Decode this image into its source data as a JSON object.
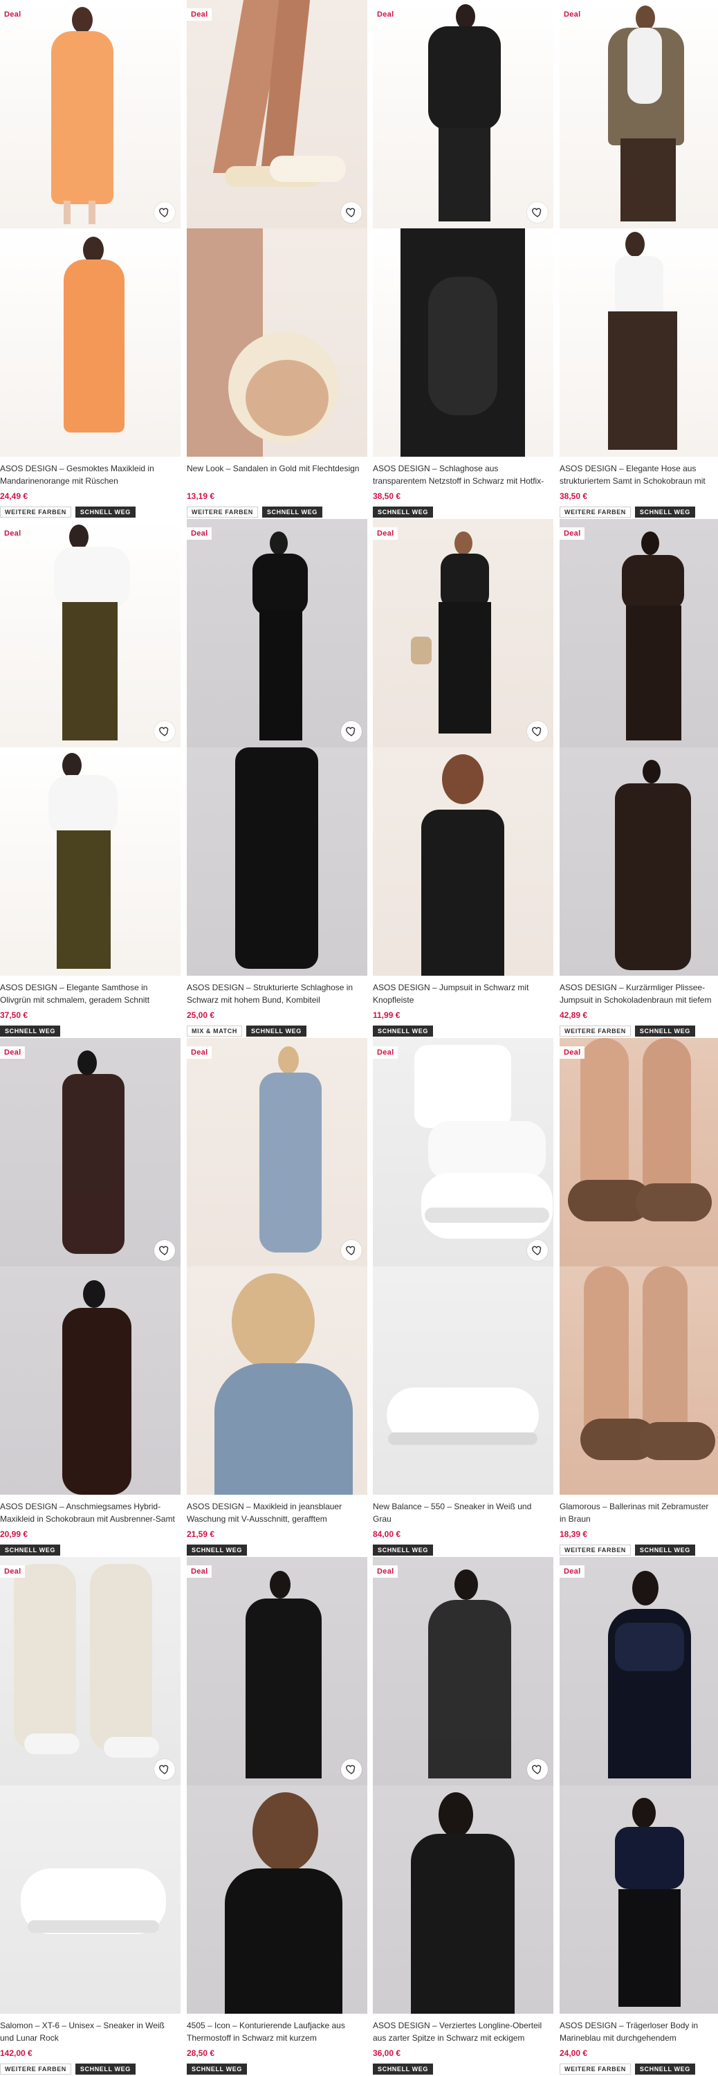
{
  "products": [
    {
      "deal": "Deal",
      "title": "ASOS DESIGN – Gesmoktes Maxikleid in Mandarinenorange mit Rüschen",
      "price": "24,49 €",
      "tags": [
        "WEITERE FARBEN",
        "SCHNELL WEG"
      ],
      "scene": "orange"
    },
    {
      "deal": "Deal",
      "title": "New Look – Sandalen in Gold mit Flechtdesign",
      "price": "13,19 €",
      "tags": [
        "WEITERE FARBEN",
        "SCHNELL WEG"
      ],
      "scene": "sandal"
    },
    {
      "deal": "Deal",
      "title": "ASOS DESIGN – Schlaghose aus transparentem Netzstoff in Schwarz mit Hotfix-Verzierung",
      "price": "38,50 €",
      "tags": [
        "SCHNELL WEG"
      ],
      "scene": "mesh"
    },
    {
      "deal": "Deal",
      "title": "ASOS DESIGN – Elegante Hose aus strukturiertem Samt in Schokobraun mit weitem Bein",
      "price": "38,50 €",
      "tags": [
        "WEITERE FARBEN",
        "SCHNELL WEG"
      ],
      "scene": "browntrouser"
    },
    {
      "deal": "Deal",
      "title": "ASOS DESIGN – Elegante Samthose in Olivgrün mit schmalem, geradem Schnitt",
      "price": "37,50 €",
      "tags": [
        "SCHNELL WEG"
      ],
      "scene": "olive"
    },
    {
      "deal": "Deal",
      "title": "ASOS DESIGN – Strukturierte Schlaghose in Schwarz mit hohem Bund, Kombiteil",
      "price": "25,00 €",
      "tags": [
        "MIX & MATCH",
        "SCHNELL WEG"
      ],
      "scene": "blackflare"
    },
    {
      "deal": "Deal",
      "title": "ASOS DESIGN – Jumpsuit in Schwarz mit Knopfleiste",
      "price": "11,99 €",
      "tags": [
        "SCHNELL WEG"
      ],
      "scene": "jumpsuit"
    },
    {
      "deal": "Deal",
      "title": "ASOS DESIGN – Kurzärmliger Plissee-Jumpsuit in Schokoladenbraun mit tiefem Ausschnitt und...",
      "price": "42,89 €",
      "tags": [
        "WEITERE FARBEN",
        "SCHNELL WEG"
      ],
      "scene": "brownjumpsuit"
    },
    {
      "deal": "Deal",
      "title": "ASOS DESIGN – Anschmiegsames Hybrid-Maxikleid in Schokobraun mit Ausbrenner-Samt",
      "price": "20,99 €",
      "tags": [
        "SCHNELL WEG"
      ],
      "scene": "sheerdress"
    },
    {
      "deal": "Deal",
      "title": "ASOS DESIGN – Maxikleid in jeansblauer Waschung mit V-Ausschnitt, gerafftem Dekolleté un...",
      "price": "21,59 €",
      "tags": [
        "SCHNELL WEG"
      ],
      "scene": "denimdress"
    },
    {
      "deal": "Deal",
      "title": "New Balance – 550 – Sneaker in Weiß und Grau",
      "price": "84,00 €",
      "tags": [
        "SCHNELL WEG"
      ],
      "scene": "sneaker"
    },
    {
      "deal": "Deal",
      "title": "Glamorous – Ballerinas mit Zebramuster in Braun",
      "price": "18,39 €",
      "tags": [
        "WEITERE FARBEN",
        "SCHNELL WEG"
      ],
      "scene": "ballerina"
    },
    {
      "deal": "Deal",
      "title": "Salomon – XT-6 – Unisex – Sneaker in Weiß und Lunar Rock",
      "price": "142,00 €",
      "tags": [
        "WEITERE FARBEN",
        "SCHNELL WEG"
      ],
      "scene": "salomon"
    },
    {
      "deal": "Deal",
      "title": "4505 – Icon – Konturierende Laufjacke aus Thermostoff in Schwarz mit kurzem Reißverschluss",
      "price": "28,50 €",
      "tags": [
        "SCHNELL WEG"
      ],
      "scene": "jacket"
    },
    {
      "deal": "Deal",
      "title": "ASOS DESIGN – Verziertes Longline-Oberteil aus zarter Spitze in Schwarz mit eckigem Ausschnitt",
      "price": "36,00 €",
      "tags": [
        "SCHNELL WEG"
      ],
      "scene": "lace"
    },
    {
      "deal": "Deal",
      "title": "ASOS DESIGN – Trägerloser Body in Marineblau mit durchgehendem Paillettenbesatz",
      "price": "24,00 €",
      "tags": [
        "WEITERE FARBEN",
        "SCHNELL WEG"
      ],
      "scene": "sequin"
    }
  ]
}
